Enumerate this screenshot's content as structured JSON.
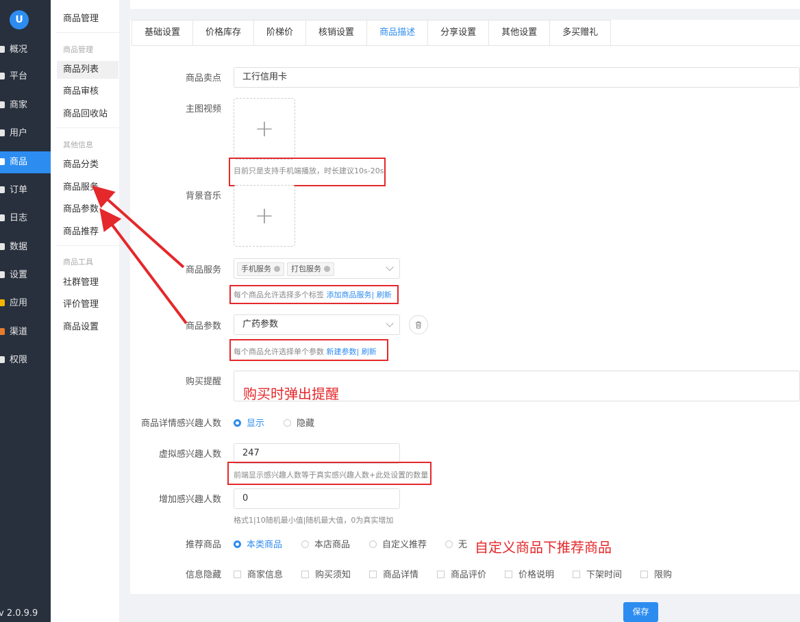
{
  "rail": {
    "logo": "U",
    "items": [
      {
        "label": "概况"
      },
      {
        "label": "平台"
      },
      {
        "label": "商家"
      },
      {
        "label": "用户"
      },
      {
        "label": "商品"
      },
      {
        "label": "订单"
      },
      {
        "label": "日志"
      },
      {
        "label": "数据"
      },
      {
        "label": "设置"
      },
      {
        "label": "应用"
      },
      {
        "label": "渠道"
      },
      {
        "label": "权限"
      }
    ],
    "version": "v 2.0.9.9"
  },
  "menu2": {
    "title": "商品管理",
    "group1": "商品管理",
    "group1_items": [
      "商品列表",
      "商品审核",
      "商品回收站"
    ],
    "group2": "其他信息",
    "group2_items": [
      "商品分类",
      "商品服务",
      "商品参数",
      "商品推荐"
    ],
    "group3": "商品工具",
    "group3_items": [
      "社群管理",
      "评价管理",
      "商品设置"
    ]
  },
  "tabs": [
    "基础设置",
    "价格库存",
    "阶梯价",
    "核销设置",
    "商品描述",
    "分享设置",
    "其他设置",
    "多买赠礼"
  ],
  "form": {
    "selling_point_label": "商品卖点",
    "selling_point_value": "工行信用卡",
    "video_label": "主图视频",
    "video_hint": "目前只是支持手机端播放，时长建议10s-20s",
    "music_label": "背景音乐",
    "service_label": "商品服务",
    "service_tags": [
      "手机服务",
      "打包服务"
    ],
    "service_hint": "每个商品允许选择多个标签",
    "service_add": "添加商品服务",
    "service_refresh": "| 刷新",
    "param_label": "商品参数",
    "param_value": "广药参数",
    "param_hint": "每个商品允许选择单个参数",
    "param_add": "新建参数",
    "param_refresh": "| 刷新",
    "remind_label": "购买提醒",
    "interest_label": "商品详情感兴趣人数",
    "interest_show": "显示",
    "interest_hide": "隐藏",
    "virtual_label": "虚拟感兴趣人数",
    "virtual_value": "247",
    "virtual_hint": "前端显示感兴趣人数等于真实感兴趣人数+此处设置的数量",
    "add_label": "增加感兴趣人数",
    "add_value": "0",
    "add_hint": "格式1|10随机最小值|随机最大值，0为真实增加",
    "recommend_label": "推荐商品",
    "recommend_options": [
      "本类商品",
      "本店商品",
      "自定义推荐",
      "无"
    ],
    "hide_label": "信息隐藏",
    "hide_options": [
      "商家信息",
      "购买须知",
      "商品详情",
      "商品评价",
      "价格说明",
      "下架时间",
      "限购"
    ]
  },
  "annotations": {
    "remind": "购买时弹出提醒",
    "recommend": "自定义商品下推荐商品"
  },
  "save_label": "保存",
  "colors": {
    "primary": "#2d8cf0",
    "annotation": "#e4282b",
    "rail": "#28303d"
  }
}
